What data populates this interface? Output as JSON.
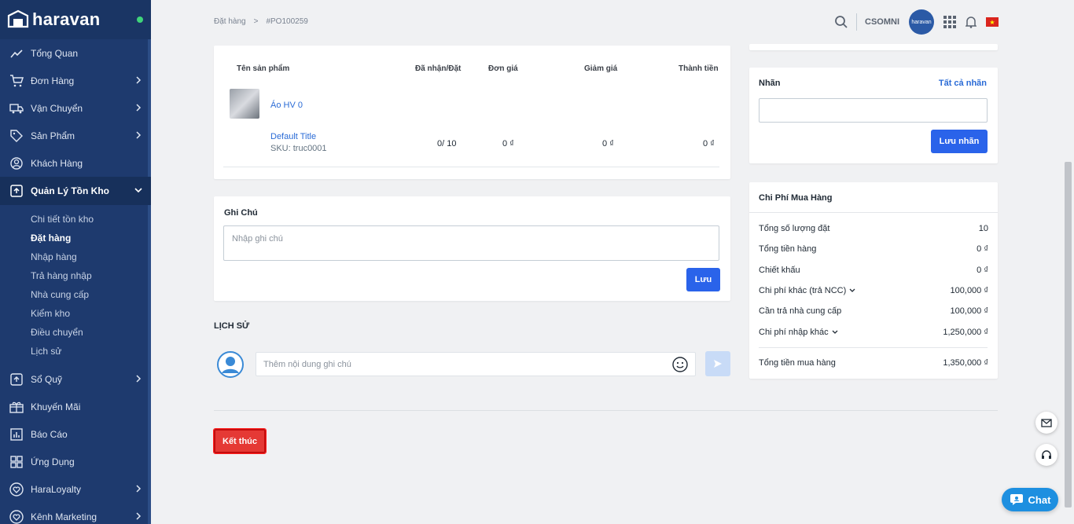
{
  "sidebar": {
    "brand": "haravan",
    "items": [
      {
        "label": "Tổng Quan",
        "icon": "chart-line-icon",
        "has_children": false
      },
      {
        "label": "Đơn Hàng",
        "icon": "cart-icon",
        "has_children": true
      },
      {
        "label": "Vận Chuyển",
        "icon": "truck-icon",
        "has_children": true
      },
      {
        "label": "Sản Phẩm",
        "icon": "tag-icon",
        "has_children": true
      },
      {
        "label": "Khách Hàng",
        "icon": "user-circle-icon",
        "has_children": false
      },
      {
        "label": "Quản Lý Tồn Kho",
        "icon": "inventory-box-icon",
        "has_children": true,
        "active": true
      }
    ],
    "subitems": [
      "Chi tiết tồn kho",
      "Đặt hàng",
      "Nhập hàng",
      "Trả hàng nhập",
      "Nhà cung cấp",
      "Kiểm kho",
      "Điều chuyển",
      "Lịch sử"
    ],
    "current_sub": "Đặt hàng",
    "items_after": [
      {
        "label": "Sổ Quỹ",
        "icon": "cashbook-icon",
        "has_children": true
      },
      {
        "label": "Khuyến Mãi",
        "icon": "gift-icon",
        "has_children": false
      },
      {
        "label": "Báo Cáo",
        "icon": "report-icon",
        "has_children": false
      },
      {
        "label": "Ứng Dụng",
        "icon": "apps-icon",
        "has_children": false
      },
      {
        "label": "HaraLoyalty",
        "icon": "heart-icon",
        "has_children": true
      },
      {
        "label": "Kênh Marketing",
        "icon": "heart-outline-icon",
        "has_children": true
      }
    ]
  },
  "breadcrumb": {
    "parent": "Đặt hàng",
    "separator": ">",
    "current": "#PO100259"
  },
  "topbar": {
    "user": "CSOMNI",
    "avatar_text": "haravan"
  },
  "products": {
    "headers": {
      "name": "Tên sản phẩm",
      "received": "Đã nhận/Đặt",
      "price": "Đơn giá",
      "discount": "Giảm giá",
      "total": "Thành tiền"
    },
    "item": {
      "name": "Áo HV 0",
      "variant": "Default Title",
      "sku": "SKU: truc0001",
      "received": "0/ 10",
      "price": "0 ₫",
      "discount": "0 ₫",
      "total": "0 ₫"
    }
  },
  "note": {
    "title": "Ghi Chú",
    "placeholder": "Nhập ghi chú",
    "save": "Lưu"
  },
  "history": {
    "title": "LỊCH SỬ",
    "placeholder": "Thêm nội dung ghi chú"
  },
  "finish_button": "Kết thúc",
  "tags": {
    "title": "Nhãn",
    "all_link": "Tất cả nhãn",
    "save": "Lưu nhãn"
  },
  "costs": {
    "title": "Chi Phí Mua Hàng",
    "rows": [
      {
        "label": "Tổng số lượng đặt",
        "value": "10"
      },
      {
        "label": "Tổng tiền hàng",
        "value": "0 ₫"
      },
      {
        "label": "Chiết khấu",
        "value": "0 ₫"
      },
      {
        "label": "Chi phí khác (trả NCC)",
        "value": "100,000 ₫"
      },
      {
        "label": "Cần trả nhà cung cấp",
        "value": "100,000 ₫"
      },
      {
        "label": "Chi phí nhập khác",
        "value": "1,250,000 ₫"
      }
    ],
    "total_label": "Tổng tiền mua hàng",
    "total_value": "1,350,000 ₫"
  },
  "chat": {
    "label": "Chat"
  },
  "colors": {
    "sidebar": "#1e3a6e",
    "primary": "#2a63ea",
    "danger": "#e53935",
    "link": "#2a6bd6"
  }
}
